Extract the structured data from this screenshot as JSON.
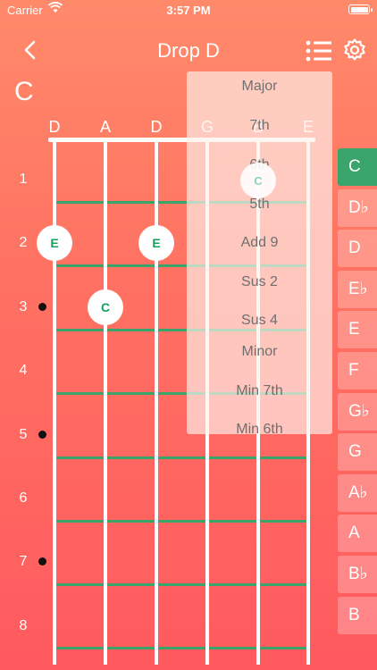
{
  "status_bar": {
    "carrier": "Carrier",
    "time": "3:57 PM"
  },
  "header": {
    "title": "Drop D"
  },
  "chord": {
    "name": "C"
  },
  "strings": [
    "D",
    "A",
    "D",
    "G",
    "B",
    "E"
  ],
  "frets": [
    "1",
    "2",
    "3",
    "4",
    "5",
    "6",
    "7",
    "8"
  ],
  "notes": [
    {
      "label": "E",
      "string_index": 0,
      "fret": 2
    },
    {
      "label": "E",
      "string_index": 2,
      "fret": 2
    },
    {
      "label": "C",
      "string_index": 1,
      "fret": 3
    }
  ],
  "dropdown": {
    "items": [
      "Major",
      "7th",
      "6th",
      "5th",
      "Add 9",
      "Sus 2",
      "Sus 4",
      "Minor",
      "Min 7th",
      "Min 6th"
    ],
    "ghost_note": "C"
  },
  "keys": {
    "items": [
      "C",
      "D♭",
      "D",
      "E♭",
      "E",
      "F",
      "G♭",
      "G",
      "A♭",
      "A",
      "B♭",
      "B"
    ],
    "selected": "C"
  },
  "colors": {
    "accent": "#3aa56a",
    "background_top": "#ff8a6a",
    "background_bottom": "#ff5a5f"
  }
}
